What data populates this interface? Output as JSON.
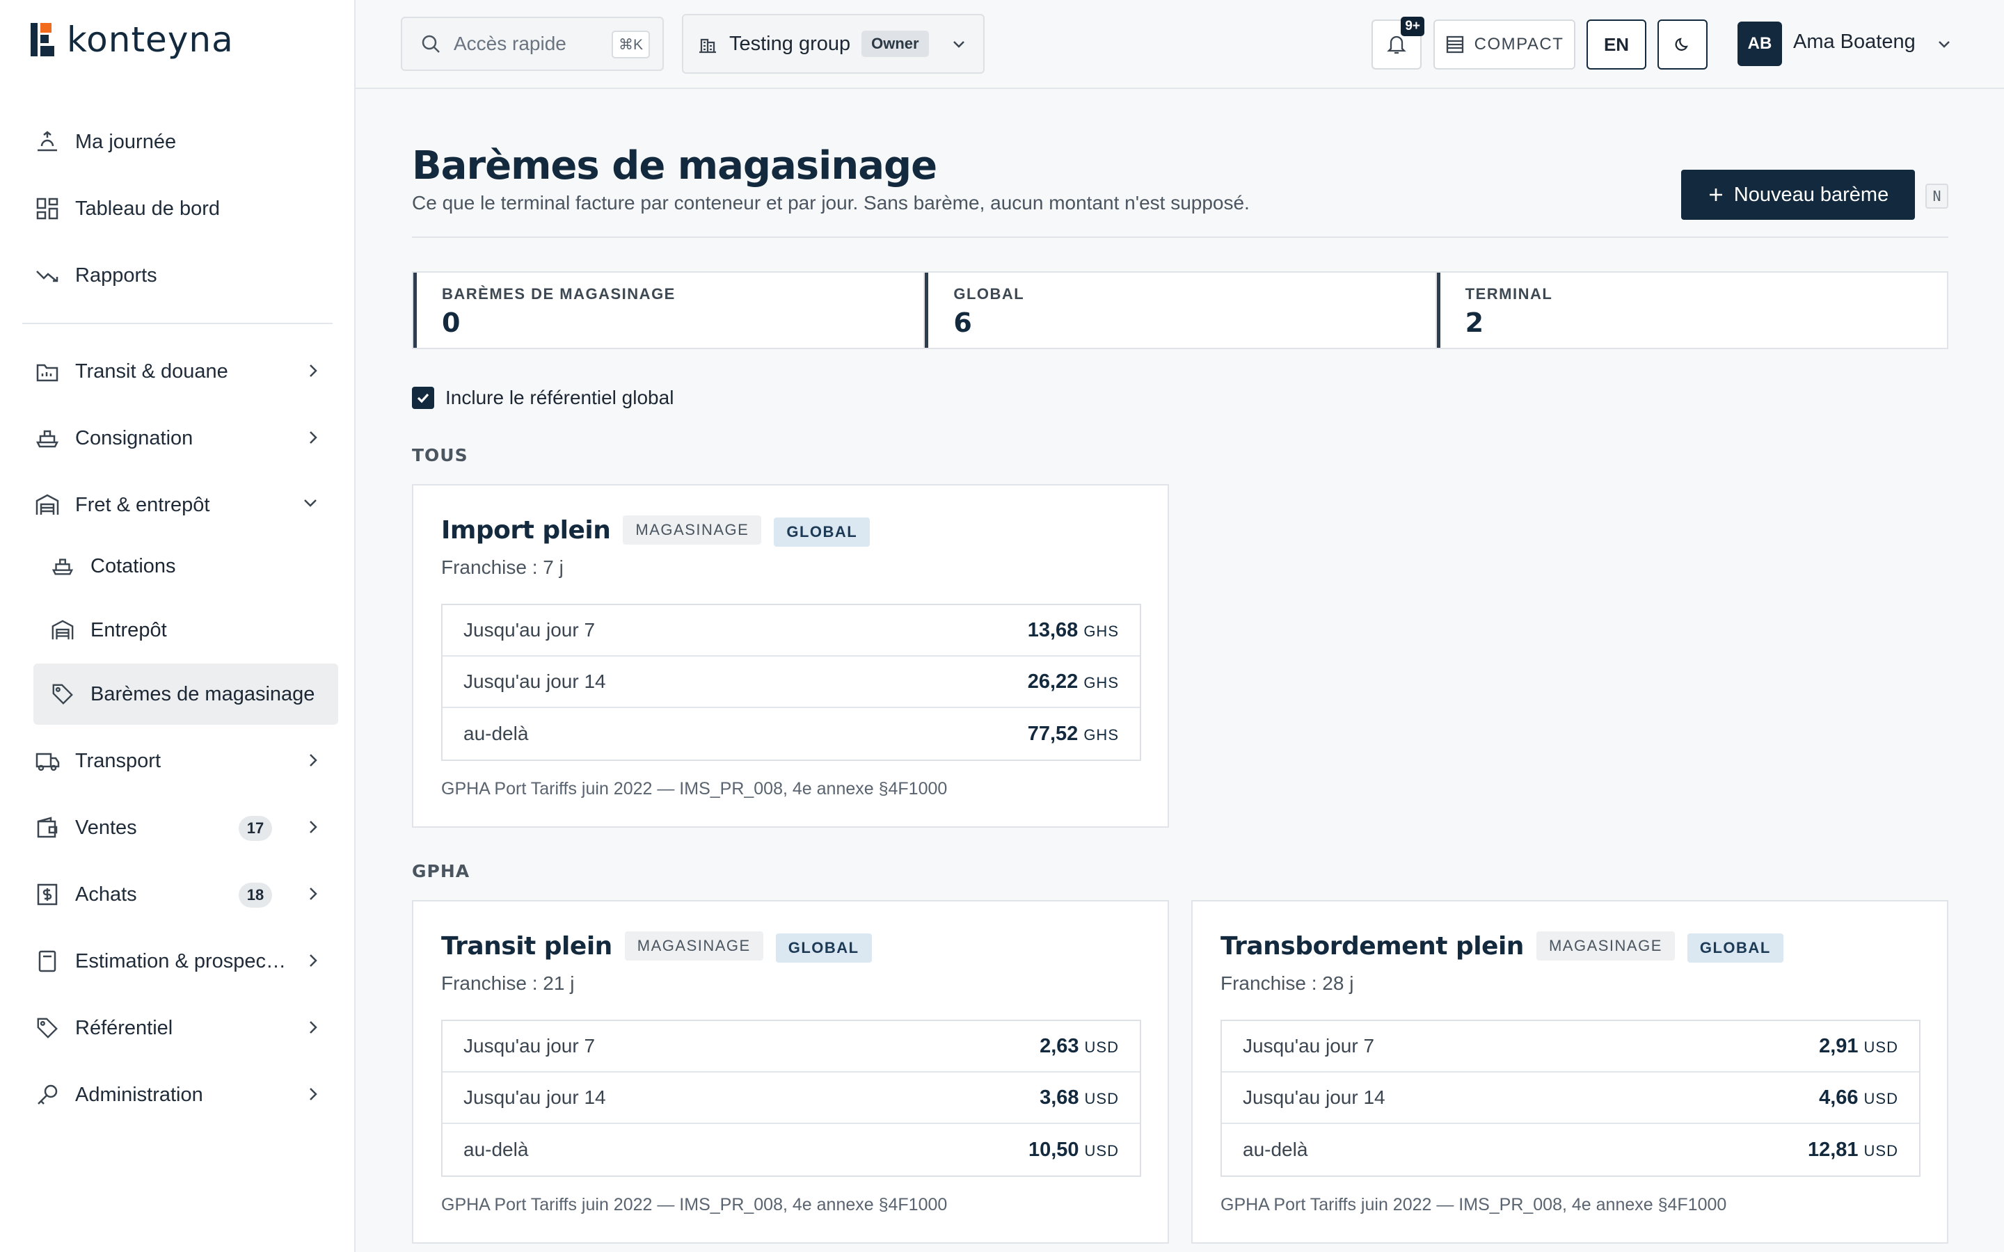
{
  "app": {
    "logo_text": "konteyna"
  },
  "sidebar": {
    "items": [
      {
        "label": "Ma journée",
        "icon": "sun-icon"
      },
      {
        "label": "Tableau de bord",
        "icon": "grid-icon"
      },
      {
        "label": "Rapports",
        "icon": "trend-icon"
      },
      {
        "label": "Transit & douane",
        "icon": "folder-icon"
      },
      {
        "label": "Consignation",
        "icon": "ship-icon"
      },
      {
        "label": "Fret & entrepôt",
        "icon": "warehouse-icon"
      },
      {
        "label": "Transport",
        "icon": "truck-icon"
      },
      {
        "label": "Ventes",
        "icon": "wallet-icon",
        "badge": "17"
      },
      {
        "label": "Achats",
        "icon": "dollar-icon",
        "badge": "18"
      },
      {
        "label": "Estimation & prospec…",
        "icon": "calculator-icon"
      },
      {
        "label": "Référentiel",
        "icon": "tag-icon"
      },
      {
        "label": "Administration",
        "icon": "key-icon"
      }
    ],
    "sub_items": [
      {
        "label": "Cotations",
        "icon": "ship-icon"
      },
      {
        "label": "Entrepôt",
        "icon": "warehouse-icon"
      },
      {
        "label": "Barèmes de magasinage",
        "icon": "tag-icon"
      }
    ]
  },
  "topbar": {
    "search_placeholder": "Accès rapide",
    "search_shortcut": "⌘K",
    "group_name": "Testing group",
    "group_role": "Owner",
    "notif_badge": "9+",
    "compact_label": "COMPACT",
    "lang_label": "EN",
    "user_initials": "AB",
    "user_name": "Ama Boateng"
  },
  "page": {
    "title": "Barèmes de magasinage",
    "subtitle": "Ce que le terminal facture par conteneur et par jour. Sans barème, aucun montant n'est supposé.",
    "new_button": "Nouveau barème",
    "new_shortcut": "N"
  },
  "stats": [
    {
      "label": "BARÈMES DE MAGASINAGE",
      "value": "0"
    },
    {
      "label": "GLOBAL",
      "value": "6"
    },
    {
      "label": "TERMINAL",
      "value": "2"
    }
  ],
  "include_global": {
    "label": "Inclure le référentiel global",
    "checked": true
  },
  "sections": [
    {
      "label": "TOUS"
    },
    {
      "label": "GPHA"
    }
  ],
  "cards": [
    {
      "title": "Import plein",
      "tag1": "MAGASINAGE",
      "tag2": "GLOBAL",
      "franchise": "Franchise : 7 j",
      "tiers": [
        {
          "label": "Jusqu'au jour 7",
          "amount": "13,68",
          "currency": "GHS"
        },
        {
          "label": "Jusqu'au jour 14",
          "amount": "26,22",
          "currency": "GHS"
        },
        {
          "label": "au-delà",
          "amount": "77,52",
          "currency": "GHS"
        }
      ],
      "source": "GPHA Port Tariffs juin 2022 — IMS_PR_008, 4e annexe §4F1000"
    },
    {
      "title": "Transit plein",
      "tag1": "MAGASINAGE",
      "tag2": "GLOBAL",
      "franchise": "Franchise : 21 j",
      "tiers": [
        {
          "label": "Jusqu'au jour 7",
          "amount": "2,63",
          "currency": "USD"
        },
        {
          "label": "Jusqu'au jour 14",
          "amount": "3,68",
          "currency": "USD"
        },
        {
          "label": "au-delà",
          "amount": "10,50",
          "currency": "USD"
        }
      ],
      "source": "GPHA Port Tariffs juin 2022 — IMS_PR_008, 4e annexe §4F1000"
    },
    {
      "title": "Transbordement plein",
      "tag1": "MAGASINAGE",
      "tag2": "GLOBAL",
      "franchise": "Franchise : 28 j",
      "tiers": [
        {
          "label": "Jusqu'au jour 7",
          "amount": "2,91",
          "currency": "USD"
        },
        {
          "label": "Jusqu'au jour 14",
          "amount": "4,66",
          "currency": "USD"
        },
        {
          "label": "au-delà",
          "amount": "12,81",
          "currency": "USD"
        }
      ],
      "source": "GPHA Port Tariffs juin 2022 — IMS_PR_008, 4e annexe §4F1000"
    }
  ]
}
